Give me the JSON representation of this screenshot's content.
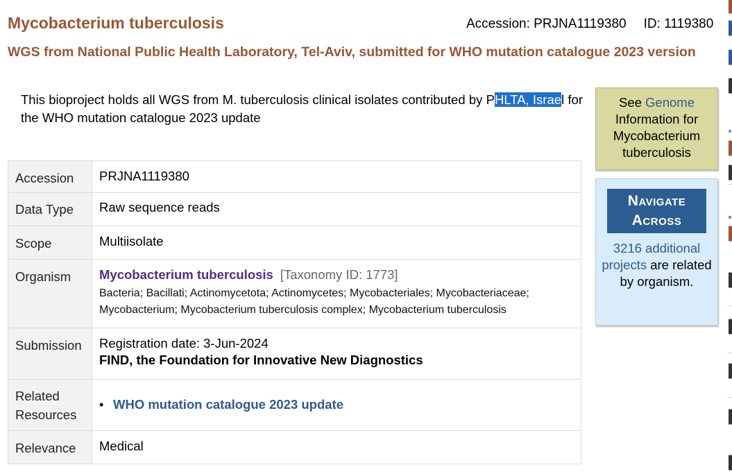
{
  "header": {
    "title": "Mycobacterium tuberculosis",
    "accession_label": "Accession: PRJNA1119380",
    "id_label": "ID: 1119380",
    "subtitle": "WGS from National Public Health Laboratory, Tel-Aviv, submitted for WHO mutation catalogue 2023 version"
  },
  "description": {
    "before": "This bioproject holds all WGS from M. tuberculosis clinical isolates contributed by P",
    "selected": "HLTA, Israe",
    "after": "l for the WHO mutation catalogue 2023 update"
  },
  "details": {
    "accession": {
      "label": "Accession",
      "value": "PRJNA1119380"
    },
    "data_type": {
      "label": "Data Type",
      "value": "Raw sequence reads"
    },
    "scope": {
      "label": "Scope",
      "value": "Multiisolate"
    },
    "organism": {
      "label": "Organism",
      "name": "Mycobacterium tuberculosis",
      "taxonomy": "[Taxonomy ID: 1773]",
      "lineage": "Bacteria; Bacillati; Actinomycetota; Actinomycetes; Mycobacteriales; Mycobacteriaceae; Mycobacterium; Mycobacterium tuberculosis complex; Mycobacterium tuberculosis"
    },
    "submission": {
      "label": "Submission",
      "date": "Registration date: 3-Jun-2024",
      "organization": "FIND, the Foundation for Innovative New Diagnostics"
    },
    "related": {
      "label": "Related Resources",
      "items": [
        "WHO mutation catalogue 2023 update"
      ]
    },
    "relevance": {
      "label": "Relevance",
      "value": "Medical"
    }
  },
  "sidebar": {
    "genome": {
      "prefix": "See ",
      "link": "Genome",
      "suffix": " Information for Mycobacterium tuberculosis"
    },
    "navigate": {
      "title": "Navigate Across",
      "link": "3216 additional projects",
      "suffix": " are related by organism."
    }
  },
  "colors": {
    "title": "#985735",
    "link": "#2f5b8f",
    "organism": "#5a2a86",
    "selection": "#1f6fd1",
    "genome_box": "#d8d8a0",
    "navigate_box": "#d9ecfb",
    "navigate_header": "#2c5e91"
  }
}
